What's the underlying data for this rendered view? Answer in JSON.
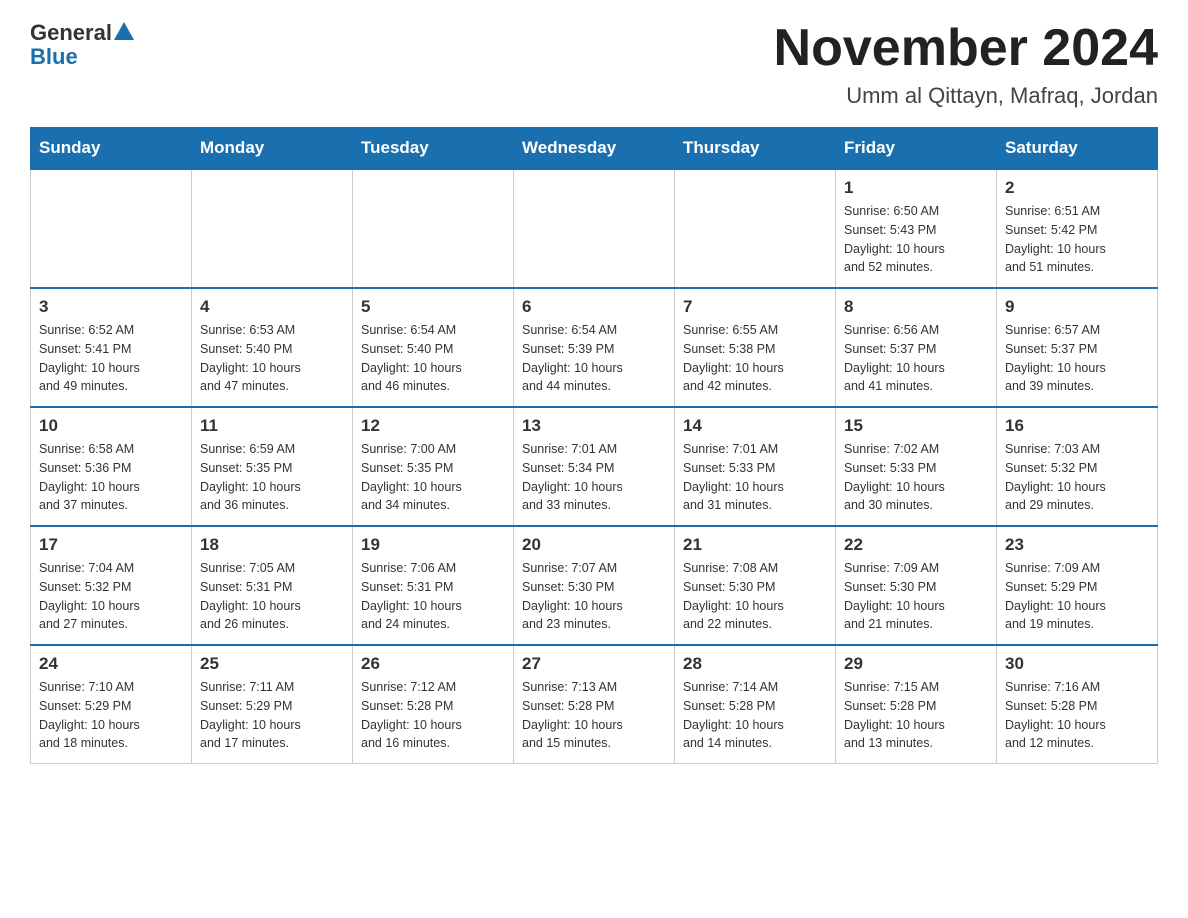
{
  "header": {
    "logo_general": "General",
    "logo_blue": "Blue",
    "title": "November 2024",
    "subtitle": "Umm al Qittayn, Mafraq, Jordan"
  },
  "weekdays": [
    "Sunday",
    "Monday",
    "Tuesday",
    "Wednesday",
    "Thursday",
    "Friday",
    "Saturday"
  ],
  "weeks": [
    [
      {
        "day": "",
        "info": ""
      },
      {
        "day": "",
        "info": ""
      },
      {
        "day": "",
        "info": ""
      },
      {
        "day": "",
        "info": ""
      },
      {
        "day": "",
        "info": ""
      },
      {
        "day": "1",
        "info": "Sunrise: 6:50 AM\nSunset: 5:43 PM\nDaylight: 10 hours\nand 52 minutes."
      },
      {
        "day": "2",
        "info": "Sunrise: 6:51 AM\nSunset: 5:42 PM\nDaylight: 10 hours\nand 51 minutes."
      }
    ],
    [
      {
        "day": "3",
        "info": "Sunrise: 6:52 AM\nSunset: 5:41 PM\nDaylight: 10 hours\nand 49 minutes."
      },
      {
        "day": "4",
        "info": "Sunrise: 6:53 AM\nSunset: 5:40 PM\nDaylight: 10 hours\nand 47 minutes."
      },
      {
        "day": "5",
        "info": "Sunrise: 6:54 AM\nSunset: 5:40 PM\nDaylight: 10 hours\nand 46 minutes."
      },
      {
        "day": "6",
        "info": "Sunrise: 6:54 AM\nSunset: 5:39 PM\nDaylight: 10 hours\nand 44 minutes."
      },
      {
        "day": "7",
        "info": "Sunrise: 6:55 AM\nSunset: 5:38 PM\nDaylight: 10 hours\nand 42 minutes."
      },
      {
        "day": "8",
        "info": "Sunrise: 6:56 AM\nSunset: 5:37 PM\nDaylight: 10 hours\nand 41 minutes."
      },
      {
        "day": "9",
        "info": "Sunrise: 6:57 AM\nSunset: 5:37 PM\nDaylight: 10 hours\nand 39 minutes."
      }
    ],
    [
      {
        "day": "10",
        "info": "Sunrise: 6:58 AM\nSunset: 5:36 PM\nDaylight: 10 hours\nand 37 minutes."
      },
      {
        "day": "11",
        "info": "Sunrise: 6:59 AM\nSunset: 5:35 PM\nDaylight: 10 hours\nand 36 minutes."
      },
      {
        "day": "12",
        "info": "Sunrise: 7:00 AM\nSunset: 5:35 PM\nDaylight: 10 hours\nand 34 minutes."
      },
      {
        "day": "13",
        "info": "Sunrise: 7:01 AM\nSunset: 5:34 PM\nDaylight: 10 hours\nand 33 minutes."
      },
      {
        "day": "14",
        "info": "Sunrise: 7:01 AM\nSunset: 5:33 PM\nDaylight: 10 hours\nand 31 minutes."
      },
      {
        "day": "15",
        "info": "Sunrise: 7:02 AM\nSunset: 5:33 PM\nDaylight: 10 hours\nand 30 minutes."
      },
      {
        "day": "16",
        "info": "Sunrise: 7:03 AM\nSunset: 5:32 PM\nDaylight: 10 hours\nand 29 minutes."
      }
    ],
    [
      {
        "day": "17",
        "info": "Sunrise: 7:04 AM\nSunset: 5:32 PM\nDaylight: 10 hours\nand 27 minutes."
      },
      {
        "day": "18",
        "info": "Sunrise: 7:05 AM\nSunset: 5:31 PM\nDaylight: 10 hours\nand 26 minutes."
      },
      {
        "day": "19",
        "info": "Sunrise: 7:06 AM\nSunset: 5:31 PM\nDaylight: 10 hours\nand 24 minutes."
      },
      {
        "day": "20",
        "info": "Sunrise: 7:07 AM\nSunset: 5:30 PM\nDaylight: 10 hours\nand 23 minutes."
      },
      {
        "day": "21",
        "info": "Sunrise: 7:08 AM\nSunset: 5:30 PM\nDaylight: 10 hours\nand 22 minutes."
      },
      {
        "day": "22",
        "info": "Sunrise: 7:09 AM\nSunset: 5:30 PM\nDaylight: 10 hours\nand 21 minutes."
      },
      {
        "day": "23",
        "info": "Sunrise: 7:09 AM\nSunset: 5:29 PM\nDaylight: 10 hours\nand 19 minutes."
      }
    ],
    [
      {
        "day": "24",
        "info": "Sunrise: 7:10 AM\nSunset: 5:29 PM\nDaylight: 10 hours\nand 18 minutes."
      },
      {
        "day": "25",
        "info": "Sunrise: 7:11 AM\nSunset: 5:29 PM\nDaylight: 10 hours\nand 17 minutes."
      },
      {
        "day": "26",
        "info": "Sunrise: 7:12 AM\nSunset: 5:28 PM\nDaylight: 10 hours\nand 16 minutes."
      },
      {
        "day": "27",
        "info": "Sunrise: 7:13 AM\nSunset: 5:28 PM\nDaylight: 10 hours\nand 15 minutes."
      },
      {
        "day": "28",
        "info": "Sunrise: 7:14 AM\nSunset: 5:28 PM\nDaylight: 10 hours\nand 14 minutes."
      },
      {
        "day": "29",
        "info": "Sunrise: 7:15 AM\nSunset: 5:28 PM\nDaylight: 10 hours\nand 13 minutes."
      },
      {
        "day": "30",
        "info": "Sunrise: 7:16 AM\nSunset: 5:28 PM\nDaylight: 10 hours\nand 12 minutes."
      }
    ]
  ]
}
